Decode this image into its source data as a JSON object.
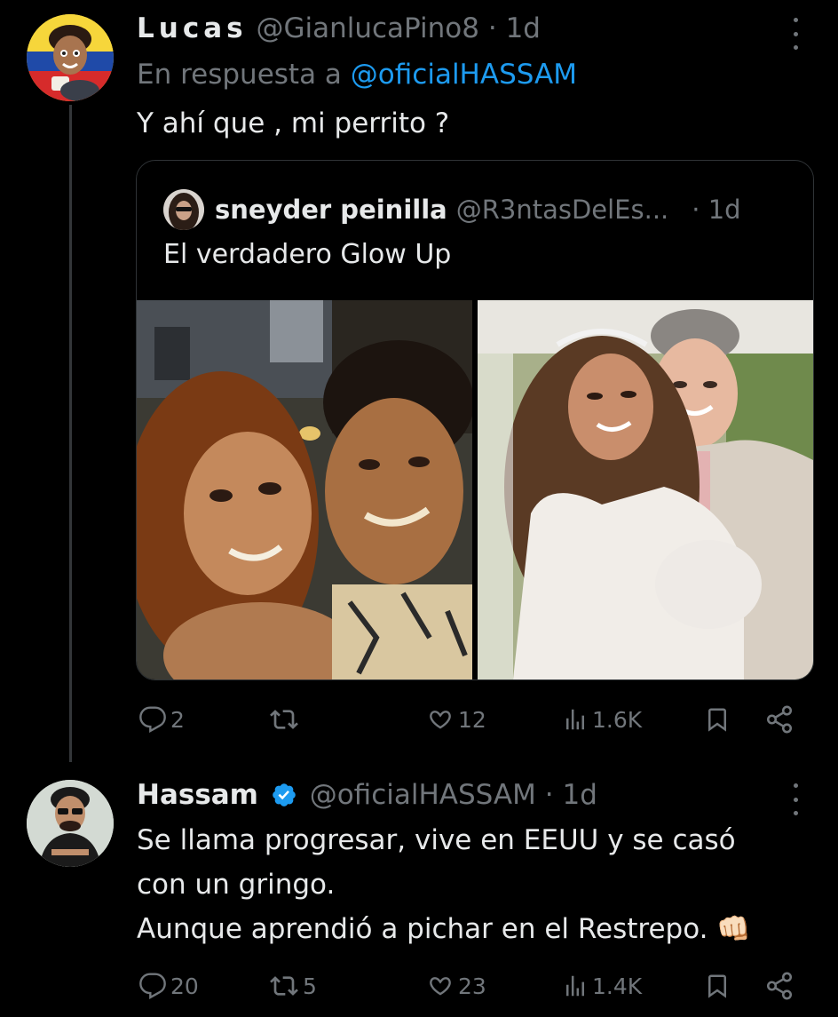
{
  "tweet1": {
    "display_name": "Lucas",
    "handle": "@GianlucaPino8",
    "separator": "·",
    "time": "1d",
    "reply_prefix": "En respuesta a",
    "reply_mention": "@oficialHASSAM",
    "text": "Y ahí que , mi perrito ?",
    "quote": {
      "display_name": "sneyder peinilla",
      "handle": "@R3ntasDelEs...",
      "time": "· 1d",
      "text": "El verdadero Glow Up"
    },
    "actions": {
      "replies": "2",
      "retweets": "",
      "likes": "12",
      "views": "1.6K"
    }
  },
  "tweet2": {
    "display_name": "Hassam",
    "handle": "@oficialHASSAM",
    "separator": "·",
    "time": "1d",
    "text_lines": [
      "Se llama progresar, vive en EEUU y se casó",
      "con un gringo.",
      "Aunque aprendió a pichar en el Restrepo. 👊🏻"
    ],
    "actions": {
      "replies": "20",
      "retweets": "5",
      "likes": "23",
      "views": "1.4K"
    }
  },
  "colors": {
    "background": "#000000",
    "text": "#e7e9ea",
    "muted": "#71767b",
    "accent": "#1d9bf0",
    "border": "#2f3336"
  },
  "icons": [
    "reply-icon",
    "retweet-icon",
    "like-icon",
    "views-icon",
    "bookmark-icon",
    "share-icon",
    "more-icon",
    "verified-badge-icon"
  ]
}
